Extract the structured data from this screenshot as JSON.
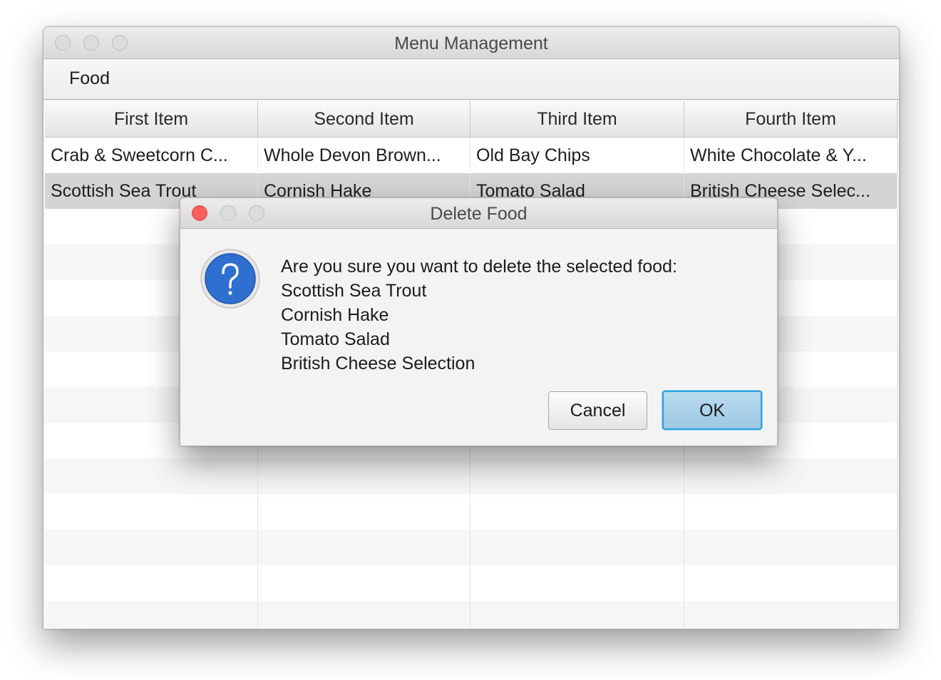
{
  "window": {
    "title": "Menu Management"
  },
  "menubar": {
    "items": [
      "Food"
    ]
  },
  "table": {
    "columns": [
      "First Item",
      "Second Item",
      "Third Item",
      "Fourth Item"
    ],
    "rows": [
      [
        "Crab & Sweetcorn C...",
        "Whole Devon Brown...",
        "Old Bay Chips",
        "White Chocolate & Y..."
      ],
      [
        "Scottish Sea Trout",
        "Cornish Hake",
        "Tomato Salad",
        "British Cheese Selec..."
      ]
    ],
    "selected_row": 2
  },
  "dialog": {
    "title": "Delete Food",
    "icon": "question-icon",
    "message": "Are you sure you want to delete the selected food:",
    "items": [
      "Scottish Sea Trout",
      "Cornish Hake",
      "Tomato Salad",
      "British Cheese Selection"
    ],
    "cancel_label": "Cancel",
    "ok_label": "OK"
  },
  "colors": {
    "close_button": "#fc605c",
    "ok_button_border": "#2ea0de",
    "question_icon": "#2f6fd0"
  }
}
